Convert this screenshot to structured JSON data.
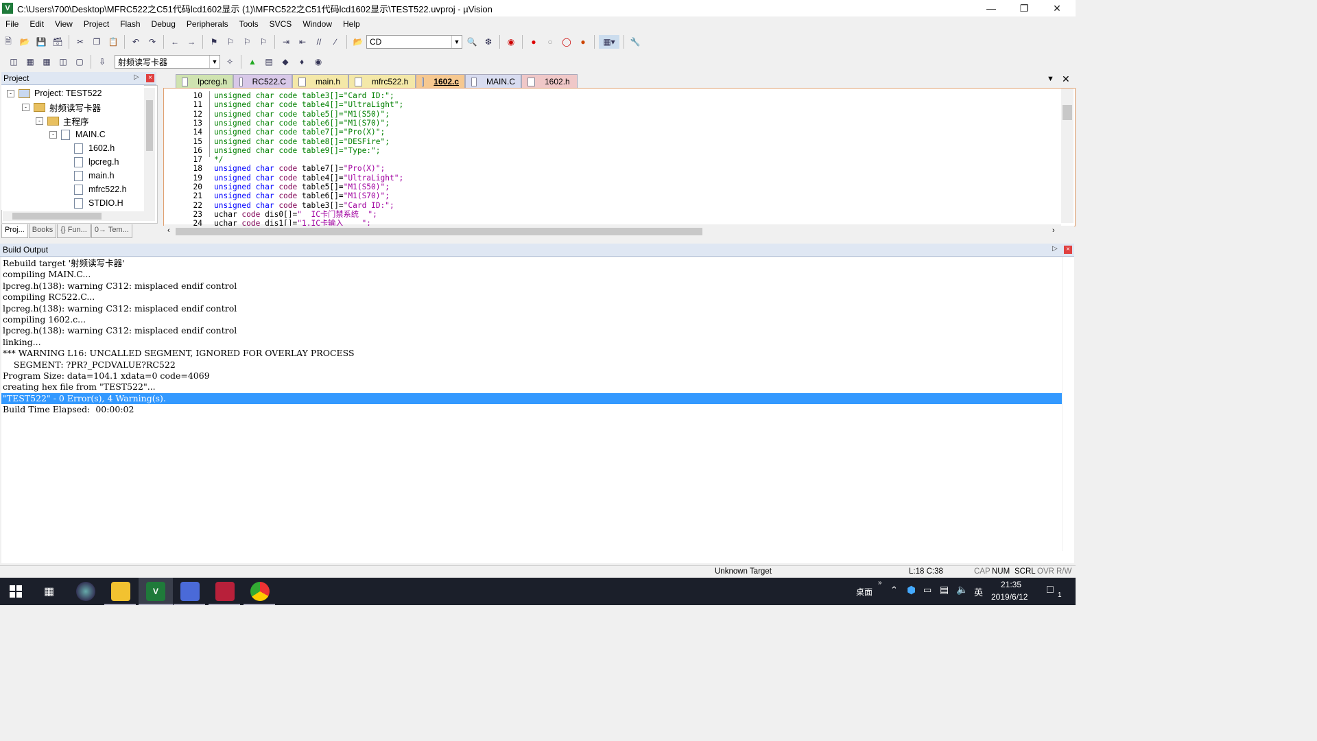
{
  "window": {
    "title": "C:\\Users\\700\\Desktop\\MFRC522之C51代码lcd1602显示 (1)\\MFRC522之C51代码lcd1602显示\\TEST522.uvproj - µVision",
    "icon": "uvision-icon"
  },
  "menu": [
    "File",
    "Edit",
    "View",
    "Project",
    "Flash",
    "Debug",
    "Peripherals",
    "Tools",
    "SVCS",
    "Window",
    "Help"
  ],
  "toolbar": {
    "find_combo_value": "CD",
    "target_combo_value": "射频读写卡器"
  },
  "project_panel": {
    "title": "Project",
    "tree": [
      {
        "label": "Project: TEST522",
        "level": 0,
        "expander": "-"
      },
      {
        "label": "射频读写卡器",
        "level": 1,
        "expander": "-"
      },
      {
        "label": "主程序",
        "level": 2,
        "expander": "-"
      },
      {
        "label": "MAIN.C",
        "level": 3,
        "expander": "-"
      },
      {
        "label": "1602.h",
        "level": 4
      },
      {
        "label": "lpcreg.h",
        "level": 4
      },
      {
        "label": "main.h",
        "level": 4
      },
      {
        "label": "mfrc522.h",
        "level": 4
      },
      {
        "label": "STDIO.H",
        "level": 4
      }
    ],
    "tabs": [
      "Proj...",
      "Books",
      "{} Fun...",
      "0→ Tem..."
    ]
  },
  "editor_tabs": [
    {
      "label": "lpcreg.h",
      "color": "#cfe3b0"
    },
    {
      "label": "RC522.C",
      "color": "#d8c8e8"
    },
    {
      "label": "main.h",
      "color": "#f4e8a8"
    },
    {
      "label": "mfrc522.h",
      "color": "#f4e8a8"
    },
    {
      "label": "1602.c",
      "color": "#f6c890",
      "active": true
    },
    {
      "label": "MAIN.C",
      "color": "#d8dcf0"
    },
    {
      "label": "1602.h",
      "color": "#f0c8c8"
    }
  ],
  "code_lines": [
    {
      "n": "10",
      "kw": "unsigned char",
      "kw2": "code",
      "id": " table3[]=",
      "str": "\"Card ID:\";",
      "comment": true
    },
    {
      "n": "11",
      "kw": "unsigned char",
      "kw2": "code",
      "id": " table4[]=",
      "str": "\"UltraLight\";",
      "comment": true
    },
    {
      "n": "12",
      "kw": "unsigned char",
      "kw2": "code",
      "id": " table5[]=",
      "str": "\"M1(S50)\";",
      "comment": true
    },
    {
      "n": "13",
      "kw": "unsigned char",
      "kw2": "code",
      "id": " table6[]=",
      "str": "\"M1(S70)\";",
      "comment": true
    },
    {
      "n": "14",
      "kw": "unsigned char",
      "kw2": "code",
      "id": " table7[]=",
      "str": "\"Pro(X)\";",
      "comment": true
    },
    {
      "n": "15",
      "kw": "unsigned char",
      "kw2": "code",
      "id": " table8[]=",
      "str": "\"DESFire\";",
      "comment": true
    },
    {
      "n": "16",
      "kw": "unsigned char",
      "kw2": "code",
      "id": " table9[]=",
      "str": "\"Type:\";",
      "comment": true
    },
    {
      "n": "17",
      "raw": "*/"
    },
    {
      "n": "18",
      "kw": "unsigned char",
      "kw2": "code",
      "id": " table7[]=",
      "str": "\"Pro(X)\";"
    },
    {
      "n": "19",
      "kw": "unsigned char",
      "kw2": "code",
      "id": " table4[]=",
      "str": "\"UltraLight\";"
    },
    {
      "n": "20",
      "kw": "unsigned char",
      "kw2": "code",
      "id": " table5[]=",
      "str": "\"M1(S50)\";"
    },
    {
      "n": "21",
      "kw": "unsigned char",
      "kw2": "code",
      "id": " table6[]=",
      "str": "\"M1(S70)\";"
    },
    {
      "n": "22",
      "kw": "unsigned char",
      "kw2": "code",
      "id": " table3[]=",
      "str": "\"Card ID:\";"
    },
    {
      "n": "23",
      "pre": "uchar ",
      "kw2": "code",
      "id": " dis0[]=",
      "str": "\"  IC卡门禁系统  \";"
    },
    {
      "n": "24",
      "pre": "uchar ",
      "kw2": "code",
      "id": " dis1[]=",
      "str": "\"1.IC卡输入    \";"
    }
  ],
  "build_output": {
    "title": "Build Output",
    "lines": [
      "Rebuild target '射频读写卡器'",
      "compiling MAIN.C...",
      "lpcreg.h(138): warning C312: misplaced endif control",
      "compiling RC522.C...",
      "lpcreg.h(138): warning C312: misplaced endif control",
      "compiling 1602.c...",
      "lpcreg.h(138): warning C312: misplaced endif control",
      "linking...",
      "*** WARNING L16: UNCALLED SEGMENT, IGNORED FOR OVERLAY PROCESS",
      "    SEGMENT: ?PR?_PCDVALUE?RC522",
      "Program Size: data=104.1 xdata=0 code=4069",
      "creating hex file from \"TEST522\"...",
      "\"TEST522\" - 0 Error(s), 4 Warning(s).",
      "Build Time Elapsed:  00:00:02"
    ],
    "selected_index": 12
  },
  "status": {
    "target": "Unknown Target",
    "position": "L:18 C:38",
    "flags": [
      "CAP",
      "NUM",
      "SCRL",
      "OVR",
      "R/W"
    ]
  },
  "taskbar": {
    "desktop_label": "桌面",
    "ime": "英",
    "time": "21:35",
    "date": "2019/6/12",
    "notif_count": "1"
  }
}
